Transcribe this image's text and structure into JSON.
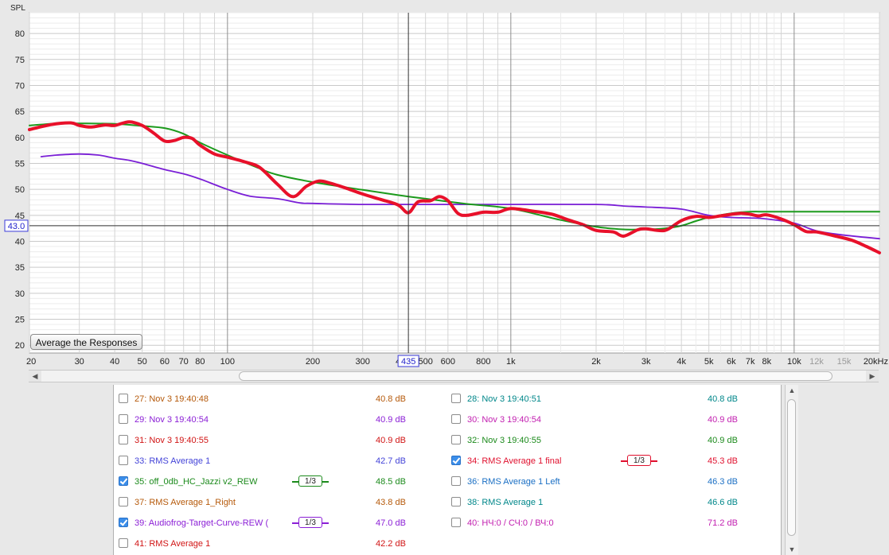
{
  "graph": {
    "y_axis_title": "SPL",
    "y_ticks": [
      "80",
      "75",
      "70",
      "65",
      "60",
      "55",
      "50",
      "45",
      "40",
      "35",
      "30",
      "25",
      "20"
    ],
    "x_ticks": [
      "20",
      "30",
      "40",
      "50",
      "60",
      "70",
      "80",
      "100",
      "200",
      "300",
      "4",
      "500",
      "600",
      "800",
      "1k",
      "2k",
      "3k",
      "4k",
      "5k",
      "6k",
      "7k",
      "8k",
      "10k",
      "12k",
      "15k",
      "20kHz"
    ],
    "cursor_x_label": "435",
    "cursor_y_label": "43.0",
    "average_button": "Average the Responses",
    "colors": {
      "red": "#e8102a",
      "green": "#1c9a1c",
      "purple": "#7a1fd6",
      "plot_bg": "#ffffff",
      "cursor": "#333333"
    }
  },
  "chart_data": {
    "type": "line",
    "xscale": "log",
    "xlim": [
      20,
      20000
    ],
    "ylim": [
      18.5,
      84
    ],
    "ylabel": "SPL",
    "cursor": {
      "x": 435,
      "y": 43.0
    },
    "series": [
      {
        "name": "34: RMS Average 1 final",
        "color": "#e8102a",
        "x": [
          20,
          24,
          28,
          30,
          33,
          37,
          40,
          45,
          50,
          55,
          60,
          65,
          70,
          75,
          80,
          90,
          100,
          115,
          130,
          150,
          170,
          190,
          210,
          230,
          260,
          300,
          350,
          400,
          435,
          470,
          520,
          560,
          600,
          650,
          700,
          800,
          900,
          1000,
          1200,
          1400,
          1600,
          1800,
          2000,
          2300,
          2500,
          2800,
          3000,
          3500,
          4000,
          4500,
          5000,
          5500,
          6000,
          6500,
          7000,
          7500,
          8000,
          9000,
          10000,
          11000,
          12000,
          14000,
          16000,
          18000,
          20000
        ],
        "y": [
          61.5,
          62.5,
          62.8,
          62.3,
          62.0,
          62.4,
          62.3,
          63.0,
          62.3,
          60.8,
          59.3,
          59.4,
          60.0,
          59.8,
          58.5,
          56.8,
          56.2,
          55.3,
          54.2,
          51.0,
          48.6,
          50.6,
          51.6,
          51.2,
          50.3,
          49.1,
          48.0,
          47.0,
          45.5,
          47.6,
          47.8,
          48.6,
          47.8,
          45.4,
          45.0,
          45.6,
          45.6,
          46.3,
          45.8,
          45.2,
          44.1,
          43.2,
          42.1,
          41.8,
          41.0,
          42.2,
          42.4,
          42.1,
          44.0,
          44.8,
          44.6,
          44.9,
          45.2,
          45.4,
          45.2,
          44.9,
          45.1,
          44.3,
          43.2,
          41.9,
          41.8,
          41.0,
          40.2,
          39.0,
          37.8
        ]
      },
      {
        "name": "35: off_0db_HC_Jazzi v2_REW",
        "color": "#1c9a1c",
        "x": [
          20,
          25,
          30,
          40,
          50,
          60,
          70,
          80,
          100,
          130,
          150,
          200,
          300,
          400,
          500,
          700,
          1000,
          1500,
          2000,
          2500,
          3000,
          3500,
          4000,
          4500,
          5000,
          6000,
          7000,
          8000,
          10000,
          15000,
          20000
        ],
        "y": [
          62.3,
          62.7,
          62.7,
          62.6,
          62.2,
          61.8,
          60.7,
          59.0,
          56.6,
          54.0,
          52.8,
          51.4,
          49.9,
          48.9,
          48.2,
          47.2,
          46.3,
          44.1,
          42.8,
          42.3,
          42.3,
          42.5,
          43.0,
          43.9,
          44.6,
          45.4,
          45.7,
          45.7,
          45.7,
          45.7,
          45.7
        ]
      },
      {
        "name": "39: Audiofrog-Target-Curve-REW (",
        "color": "#7a1fd6",
        "x": [
          22,
          25,
          30,
          35,
          40,
          45,
          50,
          60,
          70,
          80,
          100,
          120,
          150,
          180,
          200,
          300,
          500,
          1000,
          2000,
          2500,
          3000,
          4000,
          5000,
          6000,
          7000,
          8000,
          10000,
          12000,
          15000,
          20000
        ],
        "y": [
          56.3,
          56.6,
          56.8,
          56.6,
          56.0,
          55.6,
          55.0,
          53.8,
          53.0,
          52.0,
          50.0,
          48.7,
          48.2,
          47.4,
          47.3,
          47.1,
          47.1,
          47.1,
          47.1,
          46.8,
          46.6,
          46.2,
          45.0,
          44.6,
          44.5,
          44.3,
          43.5,
          42.0,
          41.2,
          40.5
        ]
      }
    ]
  },
  "list": {
    "rows": [
      {
        "l": {
          "name": "27: Nov 3 19:40:48",
          "value": "40.8 dB",
          "checked": false,
          "color": "#b5590a"
        },
        "r": {
          "name": "28: Nov 3 19:40:51",
          "value": "40.8 dB",
          "checked": false,
          "color": "#00878a"
        }
      },
      {
        "l": {
          "name": "29: Nov 3 19:40:54",
          "value": "40.9 dB",
          "checked": false,
          "color": "#8b1fd6"
        },
        "r": {
          "name": "30: Nov 3 19:40:54",
          "value": "40.9 dB",
          "checked": false,
          "color": "#c21fb0"
        }
      },
      {
        "l": {
          "name": "31: Nov 3 19:40:55",
          "value": "40.9 dB",
          "checked": false,
          "color": "#d11414"
        },
        "r": {
          "name": "32: Nov 3 19:40:55",
          "value": "40.9 dB",
          "checked": false,
          "color": "#1b8a1b"
        }
      },
      {
        "l": {
          "name": "33: RMS Average 1",
          "value": "42.7 dB",
          "checked": false,
          "color": "#4343d8"
        },
        "r": {
          "name": "34: RMS Average 1 final",
          "value": "45.3 dB",
          "checked": true,
          "color": "#e0102e",
          "smoothing": "1/3"
        }
      },
      {
        "l": {
          "name": "35: off_0db_HC_Jazzi v2_REW",
          "value": "48.5 dB",
          "checked": true,
          "color": "#1b8a1b",
          "smoothing": "1/3"
        },
        "r": {
          "name": "36: RMS Average 1 Left",
          "value": "46.3 dB",
          "checked": false,
          "color": "#1a6fc4"
        }
      },
      {
        "l": {
          "name": "37: RMS Average 1_Right",
          "value": "43.8 dB",
          "checked": false,
          "color": "#b5590a"
        },
        "r": {
          "name": "38: RMS Average 1",
          "value": "46.6 dB",
          "checked": false,
          "color": "#00878a"
        }
      },
      {
        "l": {
          "name": "39: Audiofrog-Target-Curve-REW (",
          "value": "47.0 dB",
          "checked": true,
          "color": "#8b1fd6",
          "smoothing": "1/3"
        },
        "r": {
          "name": "40: НЧ:0 / СЧ:0 / ВЧ:0",
          "value": "71.2 dB",
          "checked": false,
          "color": "#c21fb0"
        }
      },
      {
        "l": {
          "name": "41: RMS Average 1",
          "value": "42.2 dB",
          "checked": false,
          "color": "#d11414"
        }
      }
    ]
  }
}
